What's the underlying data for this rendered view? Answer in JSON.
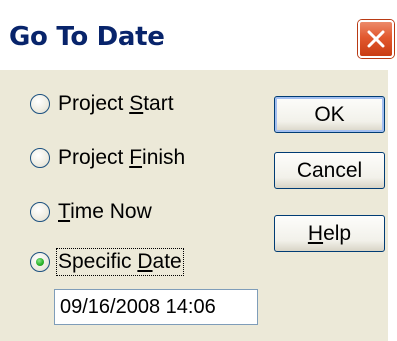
{
  "window": {
    "title": "Go To Date"
  },
  "options": [
    {
      "before": "Project ",
      "mnemonic": "S",
      "after": "tart",
      "checked": false
    },
    {
      "before": "Project ",
      "mnemonic": "F",
      "after": "inish",
      "checked": false
    },
    {
      "before": "",
      "mnemonic": "T",
      "after": "ime Now",
      "checked": false
    },
    {
      "before": "Specific ",
      "mnemonic": "D",
      "after": "ate",
      "checked": true
    }
  ],
  "date_field": {
    "value": "09/16/2008 14:06"
  },
  "buttons": {
    "ok": {
      "label": "OK"
    },
    "cancel": {
      "label": "Cancel"
    },
    "help": {
      "mnemonic": "H",
      "rest": "elp"
    }
  },
  "colors": {
    "title_text": "#08246b",
    "dialog_face": "#ece9d8",
    "radio_selected": "#2bb52b",
    "close_button": "#e2592f"
  },
  "icons": {
    "close": "close-icon"
  }
}
